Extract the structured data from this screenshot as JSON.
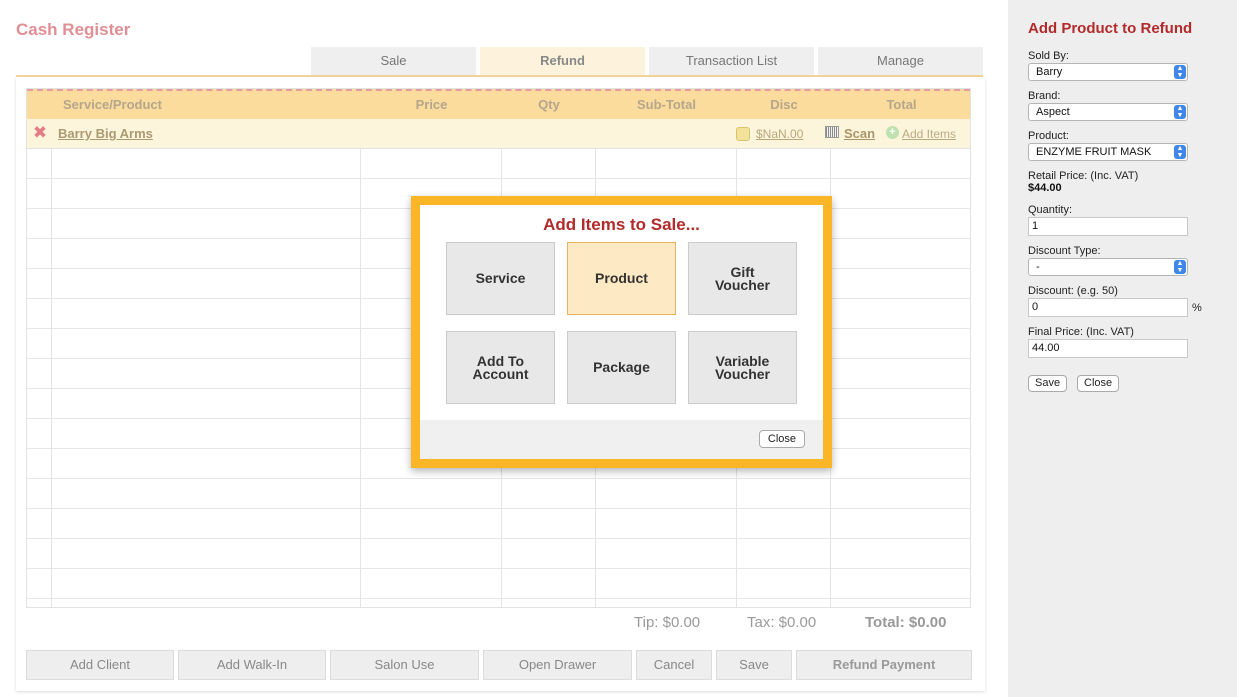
{
  "app": {
    "title": "Cash Register"
  },
  "tabs": [
    {
      "label": "Sale"
    },
    {
      "label": "Refund",
      "active": true
    },
    {
      "label": "Transaction List"
    },
    {
      "label": "Manage"
    }
  ],
  "table": {
    "columns": [
      "Service/Product",
      "Price",
      "Qty",
      "Sub-Total",
      "Disc",
      "Total"
    ],
    "client_row": {
      "name": "Barry Big Arms",
      "amount_link": "$NaN.00",
      "scan_label": "Scan",
      "add_items_label": "Add Items"
    }
  },
  "totals": {
    "tip": "Tip: $0.00",
    "tax": "Tax: $0.00",
    "total": "Total: $0.00"
  },
  "actions": {
    "add_client": "Add Client",
    "add_walk_in": "Add Walk-In",
    "salon_use": "Salon Use",
    "open_drawer": "Open Drawer",
    "cancel": "Cancel",
    "save": "Save",
    "refund_payment": "Refund Payment"
  },
  "modal": {
    "title": "Add Items to Sale...",
    "options": [
      "Service",
      "Product",
      "Gift\nVoucher",
      "Add To\nAccount",
      "Package",
      "Variable\nVoucher"
    ],
    "selected": "Product",
    "close_label": "Close"
  },
  "sidebar": {
    "title": "Add Product to Refund",
    "sold_by_label": "Sold By:",
    "sold_by_value": "Barry",
    "brand_label": "Brand:",
    "brand_value": "Aspect",
    "product_label": "Product:",
    "product_value": "ENZYME FRUIT MASK",
    "retail_label": "Retail Price: (Inc. VAT)",
    "retail_value": "$44.00",
    "quantity_label": "Quantity:",
    "quantity_value": "1",
    "discount_type_label": "Discount Type:",
    "discount_type_value": "-",
    "discount_label": "Discount: (e.g. 50)",
    "discount_value": "0",
    "percent": "%",
    "final_label": "Final Price: (Inc. VAT)",
    "final_value": "44.00",
    "save_label": "Save",
    "close_label": "Close"
  },
  "colors": {
    "accent_title": "#e08f94",
    "header_band": "#fbdc9c",
    "modal_border": "#fbb628",
    "sidebar_title": "#b32a2a"
  }
}
